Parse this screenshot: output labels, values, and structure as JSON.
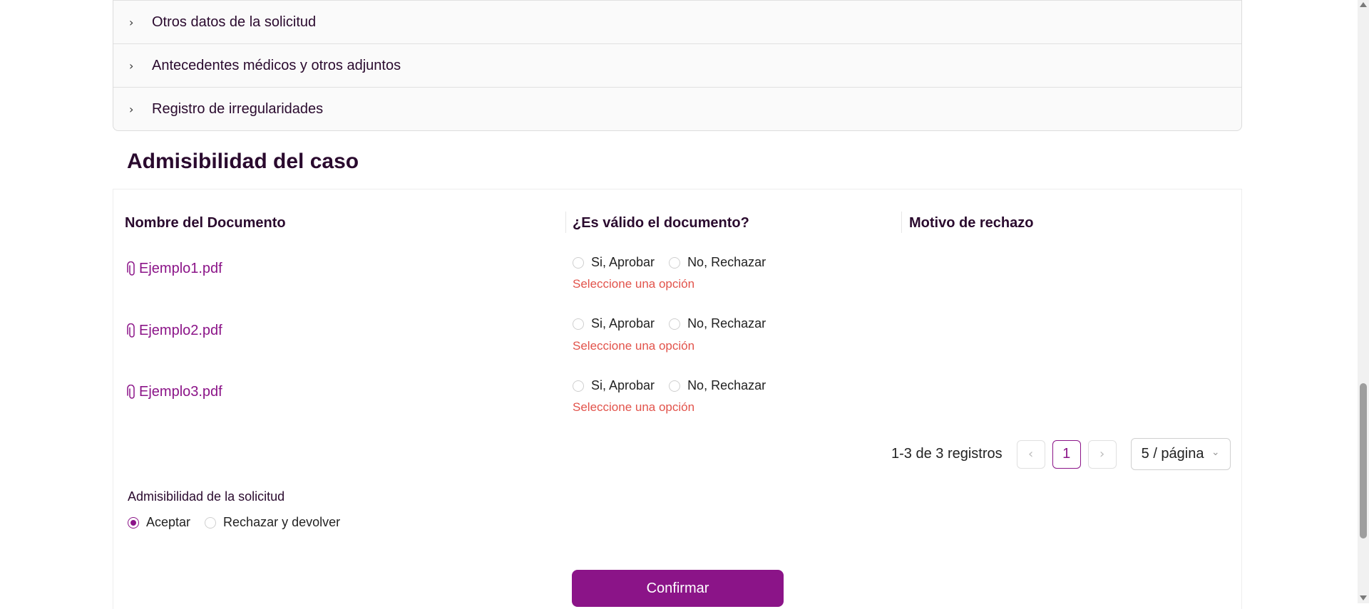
{
  "collapse_items": [
    {
      "label": "Otros datos de la solicitud"
    },
    {
      "label": "Antecedentes médicos y otros adjuntos"
    },
    {
      "label": "Registro de irregularidades"
    }
  ],
  "section_title": "Admisibilidad del caso",
  "table": {
    "headers": {
      "document": "Nombre del Documento",
      "valid": "¿Es válido el documento?",
      "reason": "Motivo de rechazo"
    },
    "rows": [
      {
        "document": "Ejemplo1.pdf",
        "approve": "Si, Aprobar",
        "reject": "No, Rechazar",
        "error": "Seleccione una opción"
      },
      {
        "document": "Ejemplo2.pdf",
        "approve": "Si, Aprobar",
        "reject": "No, Rechazar",
        "error": "Seleccione una opción"
      },
      {
        "document": "Ejemplo3.pdf",
        "approve": "Si, Aprobar",
        "reject": "No, Rechazar",
        "error": "Seleccione una opción"
      }
    ]
  },
  "pagination": {
    "total_text": "1-3 de 3 registros",
    "current_page": "1",
    "page_size": "5 / página",
    "prev_icon": "chevron-left-icon",
    "next_icon": "chevron-right-icon"
  },
  "admissibility": {
    "label": "Admisibilidad de la solicitud",
    "accept": "Aceptar",
    "reject": "Rechazar y devolver",
    "selected": "accept"
  },
  "confirm_label": "Confirmar",
  "colors": {
    "brand": "#8b1488",
    "error": "#e2534b",
    "text_dark": "#2a0a2e"
  }
}
